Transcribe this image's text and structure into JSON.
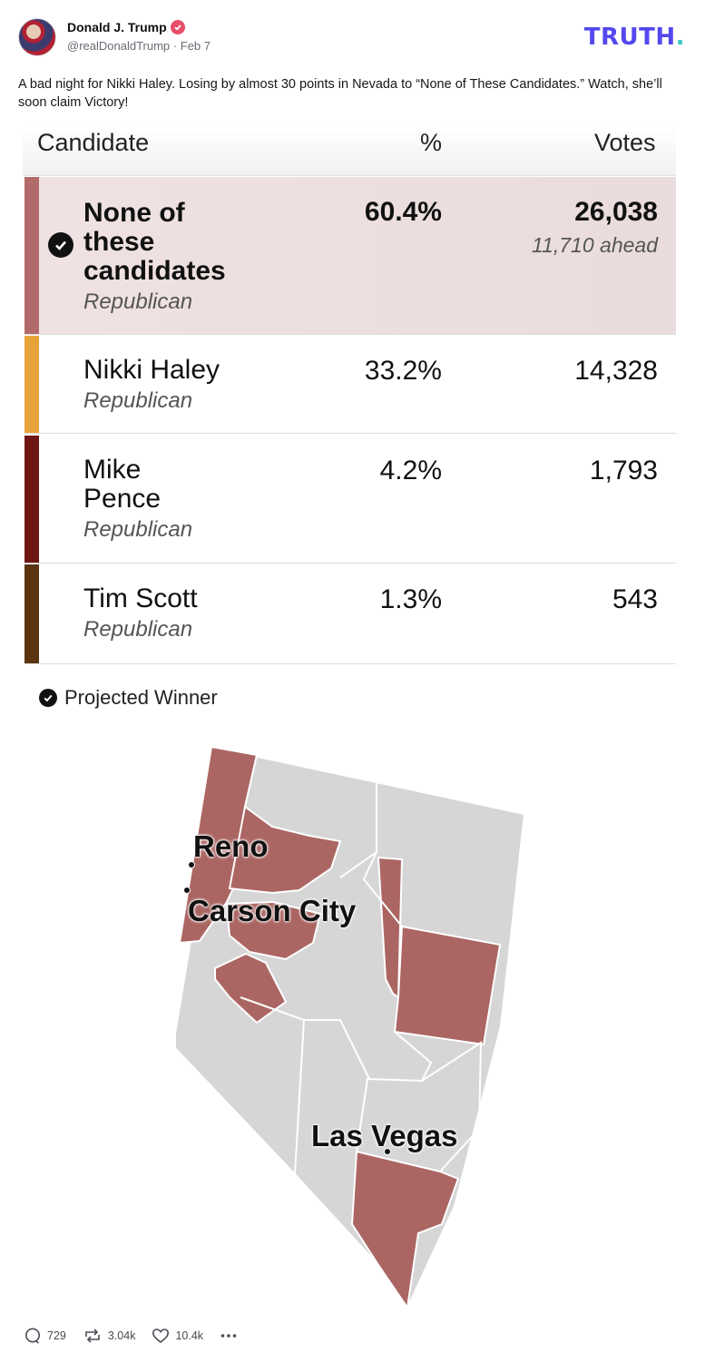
{
  "post": {
    "display_name": "Donald J. Trump",
    "handle": "@realDonaldTrump",
    "separator": "·",
    "date": "Feb 7",
    "brand": "TRUTH",
    "brand_dot": ".",
    "text": "A bad night for Nikki Haley. Losing by almost 30 points in Nevada to “None of These Candidates.” Watch, she’ll soon claim Victory!"
  },
  "results_table": {
    "headers": {
      "candidate": "Candidate",
      "percent": "%",
      "votes": "Votes"
    },
    "rows": [
      {
        "line1": "None of",
        "line2": "these",
        "line3": "candidates",
        "party": "Republican",
        "percent": "60.4%",
        "votes": "26,038",
        "ahead": "11,710 ahead",
        "winner": true,
        "color": "#b36a6a"
      },
      {
        "line1": "Nikki Haley",
        "party": "Republican",
        "percent": "33.2%",
        "votes": "14,328",
        "color": "#e8a23a"
      },
      {
        "line1": "Mike",
        "line2": "Pence",
        "party": "Republican",
        "percent": "4.2%",
        "votes": "1,793",
        "color": "#6e1610"
      },
      {
        "line1": "Tim Scott",
        "party": "Republican",
        "percent": "1.3%",
        "votes": "543",
        "color": "#5b3411"
      }
    ],
    "legend": "Projected Winner"
  },
  "map": {
    "win_color": "#ab6663",
    "other_color": "#d6d6d6",
    "cities": {
      "reno": "Reno",
      "carson": "Carson City",
      "vegas": "Las Vegas"
    }
  },
  "actions": {
    "replies": "729",
    "retruths": "3.04k",
    "likes": "10.4k",
    "more_icon": "more-icon"
  }
}
